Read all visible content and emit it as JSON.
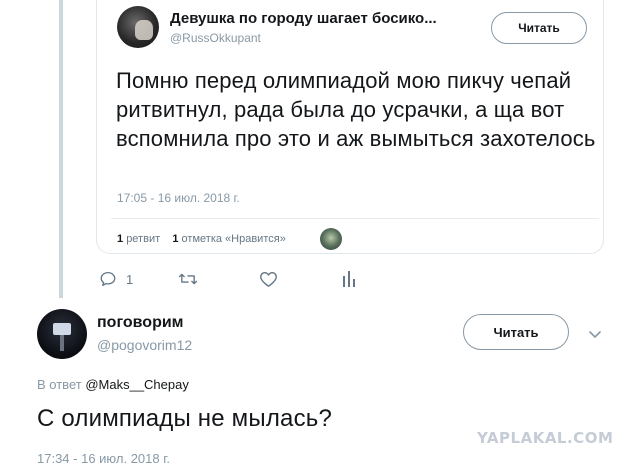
{
  "quoted_tweet": {
    "author_name": "Девушка по городу шагает босико...",
    "author_handle": "@RussOkkupant",
    "follow_label": "Читать",
    "text": "Помню перед олимпиадой мою пикчу чепай ритвитнул, рада была до усрачки, а ща вот вспомнила про это и аж вымыться захотелось",
    "timestamp": "17:05 - 16 июл. 2018 г.",
    "retweets_count": "1",
    "retweets_label": "ретвит",
    "likes_count": "1",
    "likes_label": "отметка «Нравится»"
  },
  "actions": {
    "reply_count": "1",
    "icons": [
      "reply-icon",
      "retweet-icon",
      "like-icon",
      "analytics-icon"
    ]
  },
  "reply_tweet": {
    "author_name": "поговорим",
    "author_handle": "@pogovorim12",
    "follow_label": "Читать",
    "replying_prefix": "В ответ",
    "replying_to": "@Maks__Chepay",
    "text": "С олимпиады не мылась?",
    "timestamp": "17:34 - 16 июл. 2018 г."
  },
  "watermark": "YAPLAKAL.COM",
  "colors": {
    "text": "#14171a",
    "muted": "#8899a6",
    "border": "#e1e8ed",
    "thread_line": "#ccd6dd",
    "watermark": "#c6ccd6"
  }
}
